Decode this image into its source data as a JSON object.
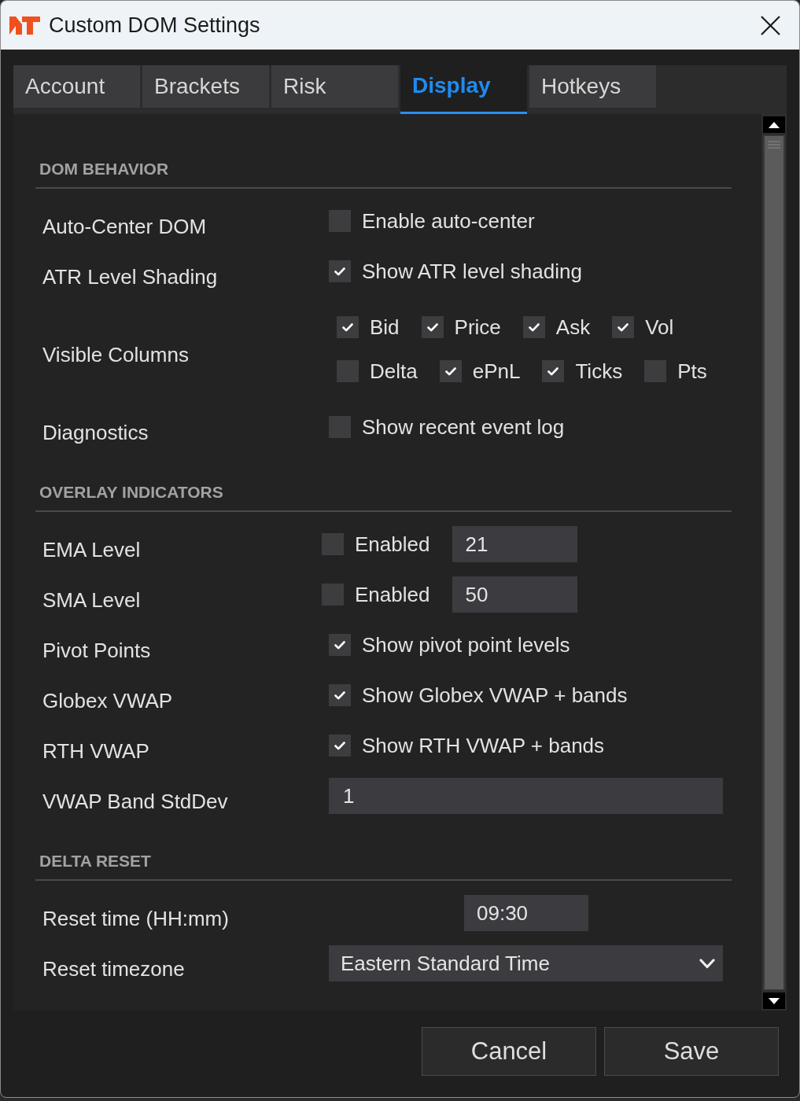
{
  "window": {
    "title": "Custom DOM Settings"
  },
  "tabs": [
    {
      "label": "Account",
      "selected": false
    },
    {
      "label": "Brackets",
      "selected": false
    },
    {
      "label": "Risk",
      "selected": false
    },
    {
      "label": "Display",
      "selected": true
    },
    {
      "label": "Hotkeys",
      "selected": false
    }
  ],
  "sections": [
    {
      "title": "DOM BEHAVIOR",
      "rows": [
        {
          "kind": "checkbox",
          "label": "Auto-Center DOM",
          "option": {
            "label": "Enable auto-center",
            "checked": false
          }
        },
        {
          "kind": "checkbox",
          "label": "ATR Level Shading",
          "option": {
            "label": "Show ATR level shading",
            "checked": true
          }
        },
        {
          "kind": "checkbox_grid",
          "label": "Visible Columns",
          "lines": [
            {
              "options": [
                {
                  "label": "Bid",
                  "checked": true
                },
                {
                  "label": "Price",
                  "checked": true
                },
                {
                  "label": "Ask",
                  "checked": true
                },
                {
                  "label": "Vol",
                  "checked": true
                }
              ]
            },
            {
              "options": [
                {
                  "label": "Delta",
                  "checked": false
                },
                {
                  "label": "ePnL",
                  "checked": true
                },
                {
                  "label": "Ticks",
                  "checked": true
                },
                {
                  "label": "Pts",
                  "checked": false
                }
              ]
            }
          ]
        },
        {
          "kind": "checkbox",
          "label": "Diagnostics",
          "option": {
            "label": "Show recent event log",
            "checked": false
          }
        }
      ]
    },
    {
      "title": "OVERLAY INDICATORS",
      "rows": [
        {
          "kind": "checkbox_field",
          "label": "EMA Level",
          "option": {
            "label": "Enabled",
            "checked": false
          },
          "value": "21"
        },
        {
          "kind": "checkbox_field",
          "label": "SMA Level",
          "option": {
            "label": "Enabled",
            "checked": false
          },
          "value": "50"
        },
        {
          "kind": "checkbox",
          "label": "Pivot Points",
          "option": {
            "label": "Show pivot point levels",
            "checked": true
          }
        },
        {
          "kind": "checkbox",
          "label": "Globex VWAP",
          "option": {
            "label": "Show Globex VWAP + bands",
            "checked": true
          }
        },
        {
          "kind": "checkbox",
          "label": "RTH VWAP",
          "option": {
            "label": "Show RTH VWAP + bands",
            "checked": true
          }
        },
        {
          "kind": "field",
          "label": "VWAP Band StdDev",
          "value": "1"
        }
      ]
    },
    {
      "title": "DELTA RESET",
      "rows": [
        {
          "kind": "time_field",
          "label": "Reset time (HH:mm)",
          "value": "09:30"
        },
        {
          "kind": "select",
          "label": "Reset timezone",
          "value": "Eastern Standard Time"
        }
      ]
    }
  ],
  "buttons": [
    "Cancel",
    "Save"
  ]
}
